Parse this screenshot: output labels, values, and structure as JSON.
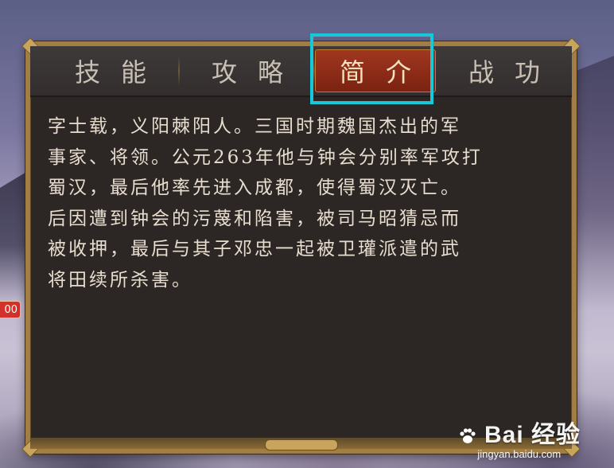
{
  "tabs": {
    "skills": "技能",
    "strategy": "攻略",
    "intro": "简介",
    "merit": "战功"
  },
  "active_tab": "intro",
  "side_badge": "00",
  "intro_text": [
    "字士载，义阳棘阳人。三国时期魏国杰出的军",
    "事家、将领。公元263年他与钟会分别率军攻打",
    "蜀汉，最后他率先进入成都，使得蜀汉灭亡。",
    "后因遭到钟会的污蔑和陷害，被司马昭猜忌而",
    "被收押，最后与其子邓忠一起被卫瓘派遣的武",
    "将田续所杀害。"
  ],
  "watermark": {
    "logo": "Bai 经验",
    "url": "jingyan.baidu.com"
  },
  "colors": {
    "highlight": "#19c8d8",
    "active_tab_bg": "#8f2c17",
    "text": "#e7ddcf"
  }
}
